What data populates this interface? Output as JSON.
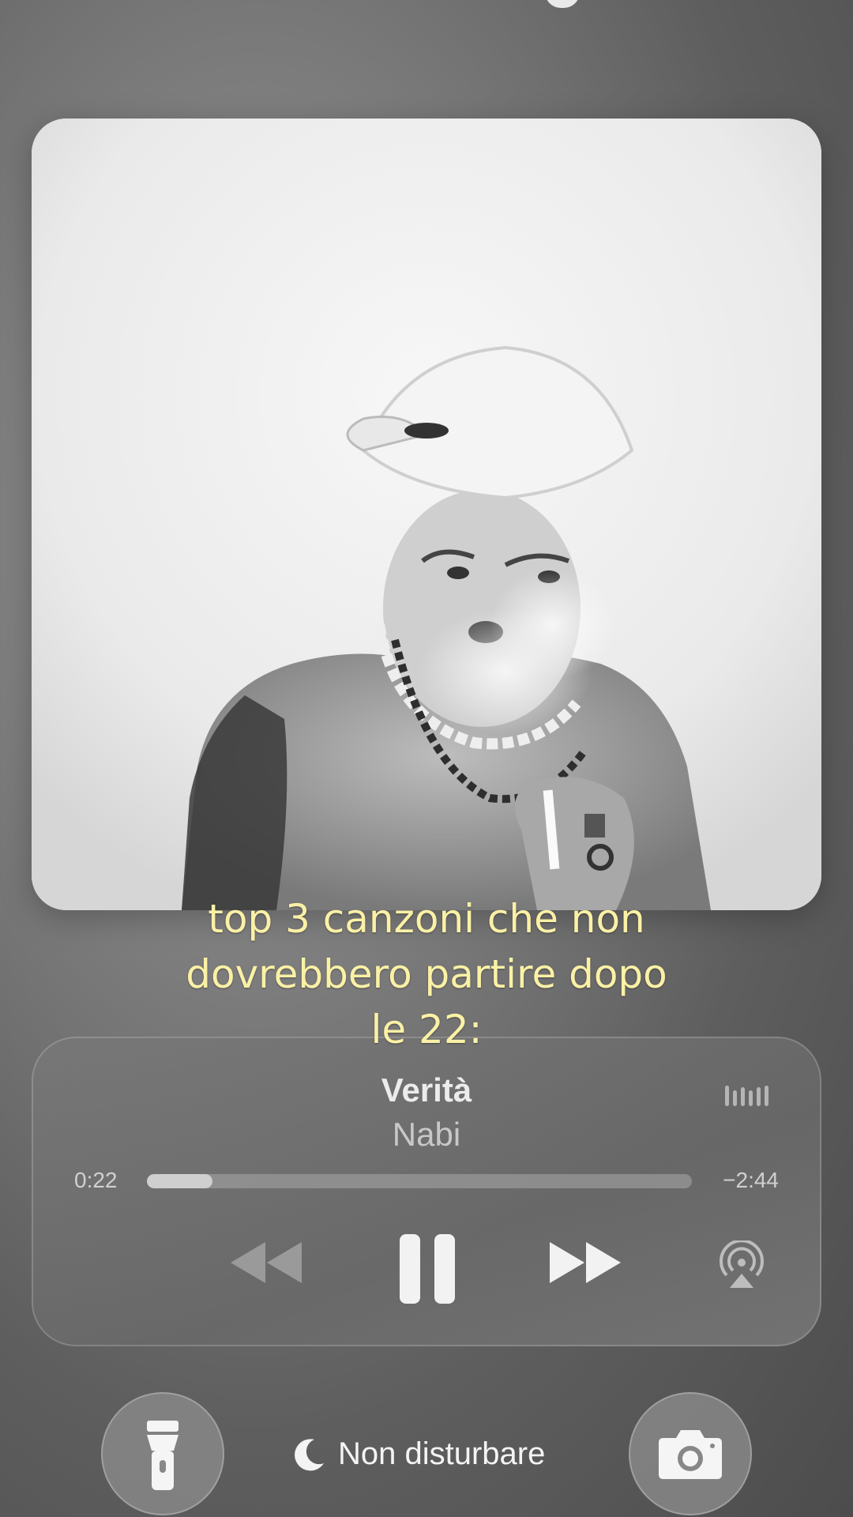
{
  "caption": {
    "text": "top 3 canzoni che non\ndovrebbero partire dopo\nle 22:"
  },
  "now_playing": {
    "title": "Verità",
    "artist": "Nabi",
    "elapsed": "0:22",
    "remaining": "−2:44",
    "progress_fraction": 0.12
  },
  "controls": {
    "rewind_icon": "rewind-icon",
    "pause_icon": "pause-icon",
    "forward_icon": "fast-forward-icon",
    "airplay_icon": "airplay-audio-icon",
    "waveform_icon": "audio-waveform-icon"
  },
  "bottom_bar": {
    "flashlight_icon": "flashlight-icon",
    "focus_label": "Non disturbare",
    "focus_icon": "moon-icon",
    "camera_icon": "camera-icon"
  },
  "colors": {
    "caption": "#fbf1a6",
    "background": "#6a6a6a"
  }
}
